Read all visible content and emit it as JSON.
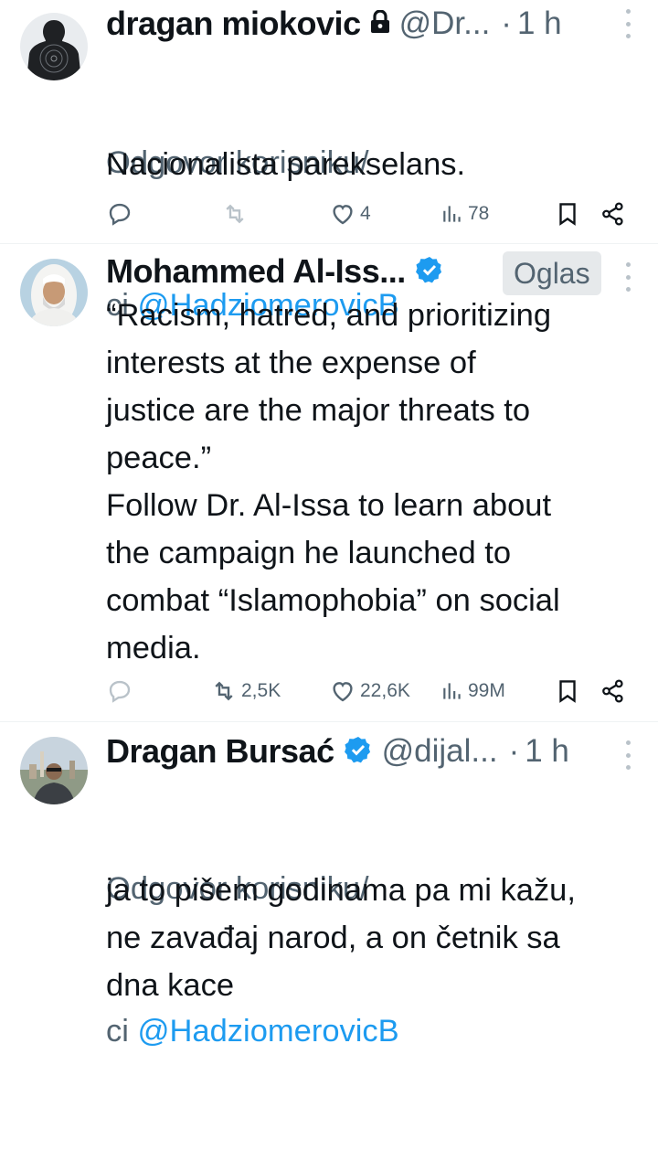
{
  "tweets": [
    {
      "name": "dragan miokovic",
      "handle": "@Dr...",
      "time": "1 h",
      "reply_prefix": "Odgovor korisniku/",
      "reply_ci": "ci ",
      "reply_to": "@HadziomerovicB",
      "body": "Nacionalista parekselans.",
      "replies": "",
      "retweets": "",
      "likes": "4",
      "views": "78"
    },
    {
      "name": "Mohammed Al-Iss...",
      "ad_label": "Oglas",
      "body": "“Racism, hatred, and prioritizing\ninterests at the expense of\njustice are the major threats to\npeace.”\nFollow Dr. Al-Issa to learn about\nthe campaign he launched to\ncombat “Islamophobia” on social\nmedia.",
      "replies": "",
      "retweets": "2,5K",
      "likes": "22,6K",
      "views": "99M"
    },
    {
      "name": "Dragan Bursać",
      "handle": "@dijal...",
      "time": "1 h",
      "reply_prefix": "Odgovor korisniku/",
      "reply_ci": "ci ",
      "reply_to": "@HadziomerovicB",
      "body": "ja to pišem godinama pa mi kažu,\nne zavađaj narod, a on četnik sa\ndna kace"
    }
  ],
  "sep": "·",
  "colors": {
    "accent": "#1d9bf0",
    "muted": "#536471",
    "text": "#0f1419",
    "divider": "#eff3f4"
  }
}
